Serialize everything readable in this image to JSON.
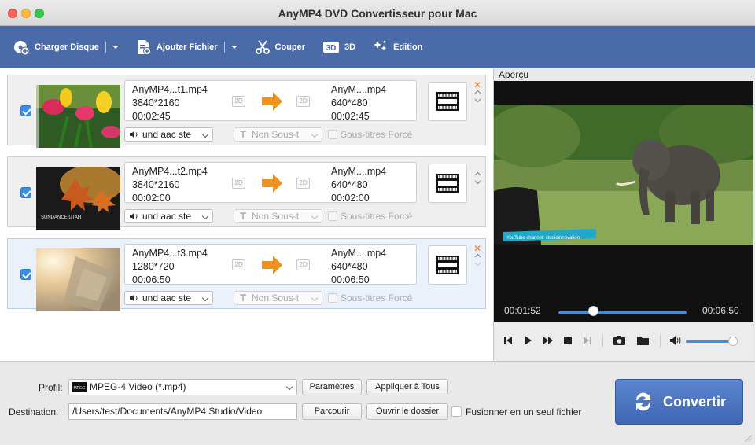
{
  "window": {
    "title": "AnyMP4 DVD Convertisseur pour Mac"
  },
  "toolbar": {
    "load_disc": "Charger Disque",
    "add_file": "Ajouter Fichier",
    "cut": "Couper",
    "three_d": "3D",
    "edit": "Edition"
  },
  "files": [
    {
      "src_name": "AnyMP4...t1.mp4",
      "src_res": "3840*2160",
      "src_dur": "00:02:45",
      "dst_name": "AnyM....mp4",
      "dst_res": "640*480",
      "dst_dur": "00:02:45",
      "badge": "2D",
      "audio": "und aac ste",
      "subtitle": "Non Sous-t",
      "forced": "Sous-titres Forcé",
      "selected": false,
      "checked": true
    },
    {
      "src_name": "AnyMP4...t2.mp4",
      "src_res": "3840*2160",
      "src_dur": "00:02:00",
      "dst_name": "AnyM....mp4",
      "dst_res": "640*480",
      "dst_dur": "00:02:00",
      "badge": "2D",
      "audio": "und aac ste",
      "subtitle": "Non Sous-t",
      "forced": "Sous-titres Forcé",
      "selected": false,
      "checked": true,
      "thumb_text": "SUNDANCE UTAH"
    },
    {
      "src_name": "AnyMP4...t3.mp4",
      "src_res": "1280*720",
      "src_dur": "00:06:50",
      "dst_name": "AnyM....mp4",
      "dst_res": "640*480",
      "dst_dur": "00:06:50",
      "badge": "2D",
      "audio": "und aac ste",
      "subtitle": "Non Sous-t",
      "forced": "Sous-titres Forcé",
      "selected": true,
      "checked": true
    }
  ],
  "preview": {
    "label": "Aperçu",
    "overlay_text": "YouTube channel: studioinnovation",
    "current_time": "00:01:52",
    "total_time": "00:06:50",
    "seek_fraction": 0.27,
    "volume_fraction": 0.85
  },
  "bottom": {
    "profile_label": "Profil:",
    "profile_value": "MPEG-4 Video (*.mp4)",
    "profile_icon_text": "MPEG",
    "settings_button": "Paramètres",
    "apply_all_button": "Appliquer à Tous",
    "destination_label": "Destination:",
    "destination_value": "/Users/test/Documents/AnyMP4 Studio/Video",
    "browse_button": "Parcourir",
    "open_folder_button": "Ouvrir le dossier",
    "merge_label": "Fusionner en un seul fichier",
    "convert_button": "Convertir"
  },
  "colors": {
    "toolbar": "#4a6aa8",
    "accent": "#3a8ee6",
    "arrow": "#f0921e",
    "convert": "#4a72c0"
  }
}
